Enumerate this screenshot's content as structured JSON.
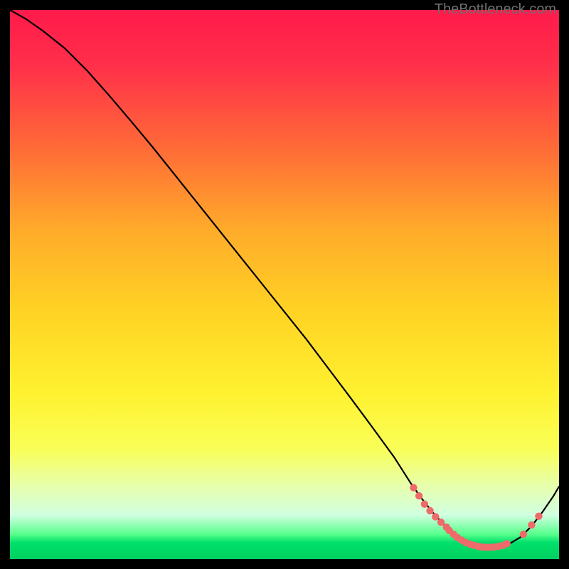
{
  "watermark": "TheBottleneck.com",
  "chart_data": {
    "type": "line",
    "title": "",
    "xlabel": "",
    "ylabel": "",
    "xlim": [
      0,
      100
    ],
    "ylim": [
      0,
      100
    ],
    "gradient_stops": [
      {
        "offset": 0.0,
        "color": "#ff1a4b"
      },
      {
        "offset": 0.1,
        "color": "#ff2f4a"
      },
      {
        "offset": 0.25,
        "color": "#ff6a37"
      },
      {
        "offset": 0.4,
        "color": "#ffab2a"
      },
      {
        "offset": 0.55,
        "color": "#ffd324"
      },
      {
        "offset": 0.7,
        "color": "#fff230"
      },
      {
        "offset": 0.8,
        "color": "#f9ff58"
      },
      {
        "offset": 0.87,
        "color": "#e6ffb0"
      },
      {
        "offset": 0.92,
        "color": "#d0ffe0"
      },
      {
        "offset": 0.955,
        "color": "#57ff8c"
      },
      {
        "offset": 0.97,
        "color": "#00e06a"
      },
      {
        "offset": 1.0,
        "color": "#00d060"
      }
    ],
    "series": [
      {
        "name": "bottleneck-curve",
        "x": [
          0,
          3,
          6,
          10,
          14,
          18,
          22,
          26,
          30,
          34,
          38,
          42,
          46,
          50,
          54,
          58,
          62,
          66,
          70,
          73,
          75,
          77,
          79,
          81,
          83,
          85,
          87,
          89,
          91,
          93,
          95,
          97,
          99,
          100
        ],
        "y": [
          100,
          98.3,
          96.2,
          93.0,
          89.0,
          84.5,
          79.8,
          75.0,
          70.0,
          65.0,
          60.0,
          55.0,
          50.0,
          45.0,
          40.0,
          34.7,
          29.4,
          24.0,
          18.5,
          13.8,
          11.0,
          8.5,
          6.3,
          4.6,
          3.4,
          2.6,
          2.2,
          2.2,
          2.8,
          4.0,
          6.0,
          8.6,
          11.5,
          13.2
        ]
      }
    ],
    "markers": {
      "name": "highlight-dots",
      "color": "#ef6a6a",
      "points": [
        {
          "x": 73.5,
          "y": 13.0
        },
        {
          "x": 74.5,
          "y": 11.5
        },
        {
          "x": 75.5,
          "y": 10.0
        },
        {
          "x": 76.5,
          "y": 8.8
        },
        {
          "x": 77.5,
          "y": 7.7
        },
        {
          "x": 78.5,
          "y": 6.7
        },
        {
          "x": 79.5,
          "y": 5.8
        },
        {
          "x": 80.0,
          "y": 5.2
        },
        {
          "x": 80.8,
          "y": 4.5
        },
        {
          "x": 81.5,
          "y": 3.9
        },
        {
          "x": 82.3,
          "y": 3.4
        },
        {
          "x": 83.0,
          "y": 3.0
        },
        {
          "x": 83.8,
          "y": 2.7
        },
        {
          "x": 84.5,
          "y": 2.5
        },
        {
          "x": 85.3,
          "y": 2.3
        },
        {
          "x": 86.0,
          "y": 2.2
        },
        {
          "x": 86.8,
          "y": 2.15
        },
        {
          "x": 87.5,
          "y": 2.15
        },
        {
          "x": 88.3,
          "y": 2.2
        },
        {
          "x": 89.0,
          "y": 2.3
        },
        {
          "x": 89.8,
          "y": 2.5
        },
        {
          "x": 90.5,
          "y": 2.8
        },
        {
          "x": 93.5,
          "y": 4.5
        },
        {
          "x": 95.0,
          "y": 6.2
        },
        {
          "x": 96.3,
          "y": 7.8
        }
      ]
    }
  }
}
